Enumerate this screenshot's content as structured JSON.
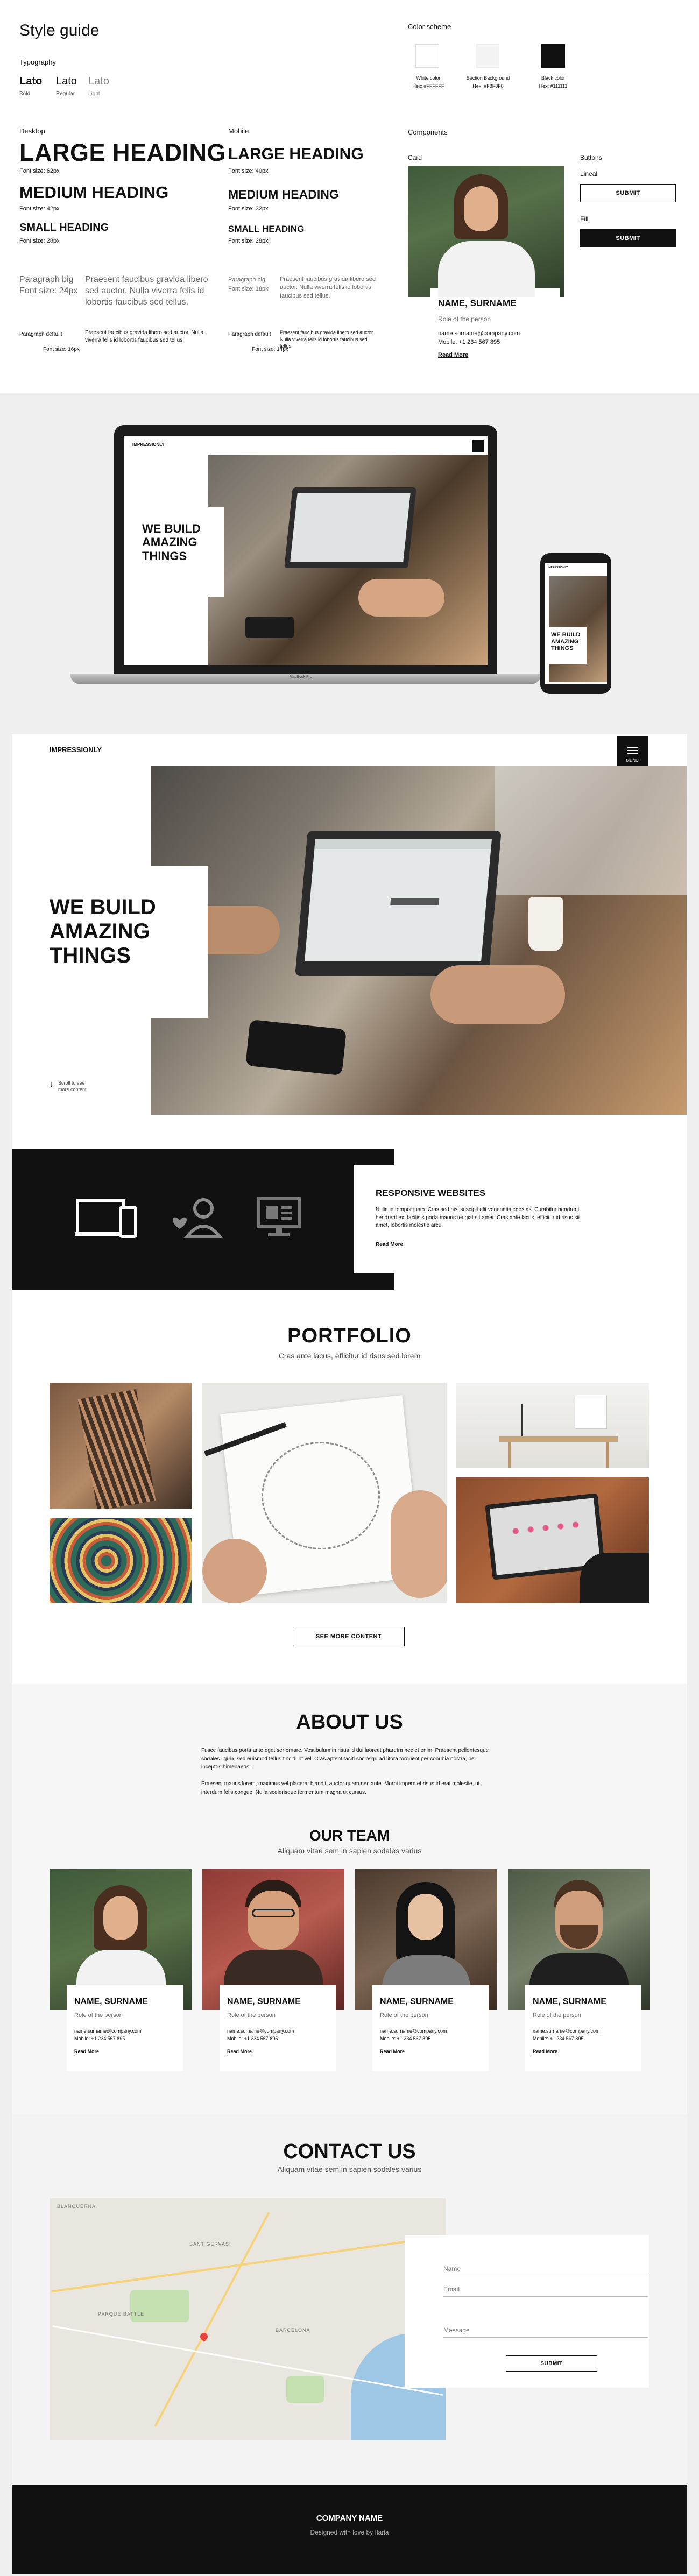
{
  "style_guide": {
    "title": "Style guide",
    "typography_label": "Typography",
    "fonts": [
      {
        "name": "Lato",
        "weight": "Bold"
      },
      {
        "name": "Lato",
        "weight": "Regular"
      },
      {
        "name": "Lato",
        "weight": "Light"
      }
    ],
    "desktop": {
      "label": "Desktop",
      "large": "LARGE HEADING",
      "large_size": "Font size: 62px",
      "medium": "MEDIUM HEADING",
      "medium_size": "Font size: 42px",
      "small": "SMALL HEADING",
      "small_size": "Font size: 28px",
      "pbig_label": "Paragraph big\nFont size: 24px",
      "pbig_text": "Praesent faucibus gravida libero sed auctor. Nulla viverra felis id lobortis faucibus sed tellus.",
      "pdef_label": "Paragraph default",
      "pdef_text": "Praesent faucibus gravida libero sed auctor. Nulla viverra felis id lobortis faucibus sed tellus.",
      "pdef_size": "Font size: 16px"
    },
    "mobile": {
      "label": "Mobile",
      "large": "LARGE HEADING",
      "large_size": "Font size: 40px",
      "medium": "MEDIUM HEADING",
      "medium_size": "Font size: 32px",
      "small": "SMALL HEADING",
      "small_size": "Font size: 28px",
      "pbig_label": "Paragraph big\nFont size: 18px",
      "pbig_text": "Praesent faucibus gravida libero sed auctor. Nulla viverra felis id lobortis faucibus sed tellus.",
      "pdef_label": "Paragraph default",
      "pdef_text": "Praesent faucibus gravida libero sed auctor. Nulla viverra felis id lobortis faucibus sed tellus.",
      "pdef_size": "Font size: 14px"
    },
    "color_scheme_label": "Color scheme",
    "colors": [
      {
        "name": "White color",
        "hex": "Hex: #FFFFFF",
        "value": "#ffffff"
      },
      {
        "name": "Section Background",
        "hex": "Hex: #F8F8F8",
        "value": "#f8f8f8"
      },
      {
        "name": "Black color",
        "hex": "Hex: #111111",
        "value": "#111111"
      }
    ],
    "components_label": "Components",
    "card_label": "Card",
    "buttons_label": "Buttons",
    "lineal_label": "Lineal",
    "fill_label": "Fill",
    "submit": "SUBMIT",
    "card": {
      "name": "NAME, SURNAME",
      "role": "Role of the person",
      "email": "name.surname@company.com",
      "mobile": "Mobile: +1 234 567 895",
      "link": "Read More"
    }
  },
  "mockup": {
    "brand": "IMPRESSIONLY",
    "hero": "WE BUILD\nAMAZING\nTHINGS",
    "laptop_label": "MacBook Pro"
  },
  "site": {
    "brand": "IMPRESSIONLY",
    "menu_label": "MENU",
    "hero_title": "WE BUILD\nAMAZING\nTHINGS",
    "scroll_hint": "Scroll to see\nmore content",
    "services": {
      "title": "RESPONSIVE WEBSITES",
      "text": "Nulla in tempor justo. Cras sed nisi suscipit elit venenatis egestas. Curabitur hendrerit hendrerit ex, facilisis porta mauris feugiat sit amet. Cras ante lacus, efficitur id risus sit amet, lobortis molestie arcu.",
      "link": "Read More",
      "icons": [
        "devices-icon",
        "team-heart-icon",
        "presentation-icon"
      ]
    },
    "portfolio": {
      "title": "PORTFOLIO",
      "subtitle": "Cras ante lacus, efficitur id risus sed lorem",
      "button": "SEE MORE CONTENT"
    },
    "about": {
      "title": "ABOUT US",
      "p1": "Fusce faucibus porta ante eget ser ornare. Vestibulum in risus id dui laoreet pharetra nec et enim. Praesent pellentesque sodales ligula, sed euismod tellus tincidunt vel. Cras aptent taciti sociosqu ad litora torquent per conubia nostra, per inceptos himenaeos.",
      "p2": "Praesent mauris lorem, maximus vel placerat blandit, auctor quam nec ante. Morbi imperdiet risus id erat molestie, ut interdum felis congue. Nulla scelerisque fermentum magna ut cursus."
    },
    "team": {
      "title": "OUR TEAM",
      "subtitle": "Aliquam vitae sem in sapien sodales varius",
      "members": [
        {
          "name": "NAME, SURNAME",
          "role": "Role of the person",
          "email": "name.surname@company.com",
          "mobile": "Mobile: +1 234 567 895",
          "link": "Read More"
        },
        {
          "name": "NAME, SURNAME",
          "role": "Role of the person",
          "email": "name.surname@company.com",
          "mobile": "Mobile: +1 234 567 895",
          "link": "Read More"
        },
        {
          "name": "NAME, SURNAME",
          "role": "Role of the person",
          "email": "name.surname@company.com",
          "mobile": "Mobile: +1 234 567 895",
          "link": "Read More"
        },
        {
          "name": "NAME, SURNAME",
          "role": "Role of the person",
          "email": "name.surname@company.com",
          "mobile": "Mobile: +1 234 567 895",
          "link": "Read More"
        }
      ]
    },
    "contact": {
      "title": "CONTACT US",
      "subtitle": "Aliquam vitae sem in sapien sodales varius",
      "name_ph": "Name",
      "email_ph": "Email",
      "message_ph": "Message",
      "submit": "SUBMIT",
      "map_labels": [
        "BLANQUERNA",
        "PARQUE BATTLE",
        "SANT GERVASI",
        "BARCELONA"
      ]
    },
    "footer": {
      "company": "COMPANY NAME",
      "credit": "Designed with love by Ilaria"
    }
  }
}
